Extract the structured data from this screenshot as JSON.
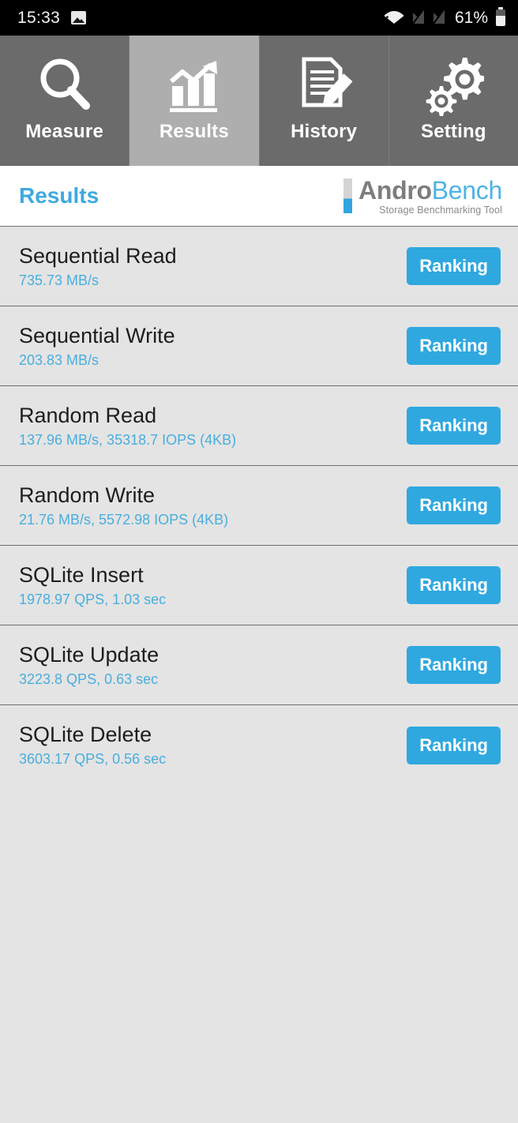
{
  "statusbar": {
    "time": "15:33",
    "battery_percent": "61%",
    "icons": [
      "image-icon",
      "wifi-icon",
      "no-sim-icon",
      "no-sim-icon",
      "battery-icon"
    ]
  },
  "tabs": [
    {
      "label": "Measure",
      "icon": "magnifier-icon",
      "active": false
    },
    {
      "label": "Results",
      "icon": "bar-chart-trend-icon",
      "active": true
    },
    {
      "label": "History",
      "icon": "document-pencil-icon",
      "active": false
    },
    {
      "label": "Setting",
      "icon": "gears-icon",
      "active": false
    }
  ],
  "header": {
    "title": "Results",
    "logo_primary": "Andro",
    "logo_secondary": "Bench",
    "logo_subtitle": "Storage Benchmarking Tool"
  },
  "button_label": "Ranking",
  "results": [
    {
      "name": "Sequential Read",
      "value": "735.73 MB/s"
    },
    {
      "name": "Sequential Write",
      "value": "203.83 MB/s"
    },
    {
      "name": "Random Read",
      "value": "137.96 MB/s, 35318.7 IOPS (4KB)"
    },
    {
      "name": "Random Write",
      "value": "21.76 MB/s, 5572.98 IOPS (4KB)"
    },
    {
      "name": "SQLite Insert",
      "value": "1978.97 QPS, 1.03 sec"
    },
    {
      "name": "SQLite Update",
      "value": "3223.8 QPS, 0.63 sec"
    },
    {
      "name": "SQLite Delete",
      "value": "3603.17 QPS, 0.56 sec"
    }
  ],
  "colors": {
    "accent_blue": "#2fa8e0",
    "value_blue": "#4aaede",
    "tab_inactive": "#6b6b6b",
    "tab_active": "#aeaeae",
    "list_bg": "#e4e4e4"
  }
}
